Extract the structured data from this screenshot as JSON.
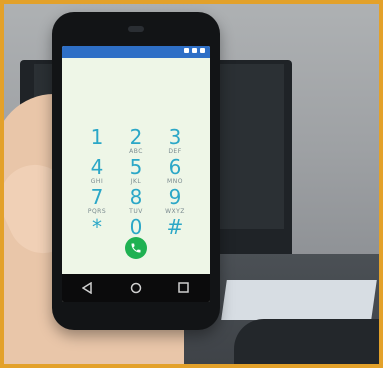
{
  "scene": {
    "device": {
      "screen": {
        "app": "Phone",
        "keypad": [
          {
            "digit": "1",
            "letters": ""
          },
          {
            "digit": "2",
            "letters": "ABC"
          },
          {
            "digit": "3",
            "letters": "DEF"
          },
          {
            "digit": "4",
            "letters": "GHI"
          },
          {
            "digit": "5",
            "letters": "JKL"
          },
          {
            "digit": "6",
            "letters": "MNO"
          },
          {
            "digit": "7",
            "letters": "PQRS"
          },
          {
            "digit": "8",
            "letters": "TUV"
          },
          {
            "digit": "9",
            "letters": "WXYZ"
          },
          {
            "digit": "*",
            "letters": ""
          },
          {
            "digit": "0",
            "letters": "+"
          },
          {
            "digit": "#",
            "letters": ""
          }
        ],
        "call_icon": "phone-icon",
        "nav_icons": [
          "back-icon",
          "home-icon",
          "recents-icon"
        ]
      }
    },
    "accent_color": "#2ba7c7",
    "call_color": "#1fb152",
    "status_bar_color": "#2e6fc6",
    "border_color": "#e3a12a"
  }
}
